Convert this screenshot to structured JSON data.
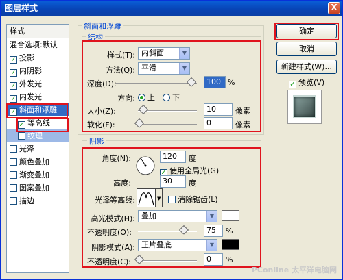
{
  "window": {
    "title": "图层样式",
    "close_glyph": "X"
  },
  "style_list": {
    "header": "样式",
    "blend_options": "混合选项:默认",
    "items": [
      {
        "label": "投影",
        "checked": true
      },
      {
        "label": "内阴影",
        "checked": true
      },
      {
        "label": "外发光",
        "checked": true
      },
      {
        "label": "内发光",
        "checked": true
      },
      {
        "label": "斜面和浮雕",
        "checked": true,
        "selected": true
      },
      {
        "label": "等高线",
        "checked": true,
        "sub": true
      },
      {
        "label": "纹理",
        "checked": false,
        "sub": true
      },
      {
        "label": "光泽",
        "checked": false
      },
      {
        "label": "颜色叠加",
        "checked": false
      },
      {
        "label": "渐变叠加",
        "checked": false
      },
      {
        "label": "图案叠加",
        "checked": false
      },
      {
        "label": "描边",
        "checked": false
      }
    ]
  },
  "bevel": {
    "group_title": "斜面和浮雕",
    "structure_title": "结构",
    "style_label": "样式(T):",
    "style_value": "内斜面",
    "method_label": "方法(Q):",
    "method_value": "平滑",
    "depth_label": "深度(D):",
    "depth_value": "100",
    "depth_unit": "%",
    "direction_label": "方向:",
    "dir_up": "上",
    "dir_down": "下",
    "size_label": "大小(Z):",
    "size_value": "10",
    "size_unit": "像素",
    "soften_label": "软化(F):",
    "soften_value": "0",
    "soften_unit": "像素"
  },
  "shading": {
    "group_title": "阴影",
    "angle_label": "角度(N):",
    "angle_value": "120",
    "angle_unit": "度",
    "global_light": "使用全局光(G)",
    "altitude_label": "高度:",
    "altitude_value": "30",
    "altitude_unit": "度",
    "gloss_label": "光泽等高线:",
    "antialias": "消除锯齿(L)",
    "highlight_label": "高光模式(H):",
    "highlight_value": "叠加",
    "hl_opacity_label": "不透明度(O):",
    "hl_opacity_value": "75",
    "hl_opacity_unit": "%",
    "shadow_label": "阴影模式(A):",
    "shadow_value": "正片叠底",
    "sh_opacity_label": "不透明度(C):",
    "sh_opacity_value": "0",
    "sh_opacity_unit": "%",
    "highlight_color": "#ffffff",
    "shadow_color": "#000000"
  },
  "buttons": {
    "ok": "确定",
    "cancel": "取消",
    "new_style": "新建样式(W)...",
    "preview": "预览(V)"
  },
  "watermark": "PConline 太平洋电脑网"
}
